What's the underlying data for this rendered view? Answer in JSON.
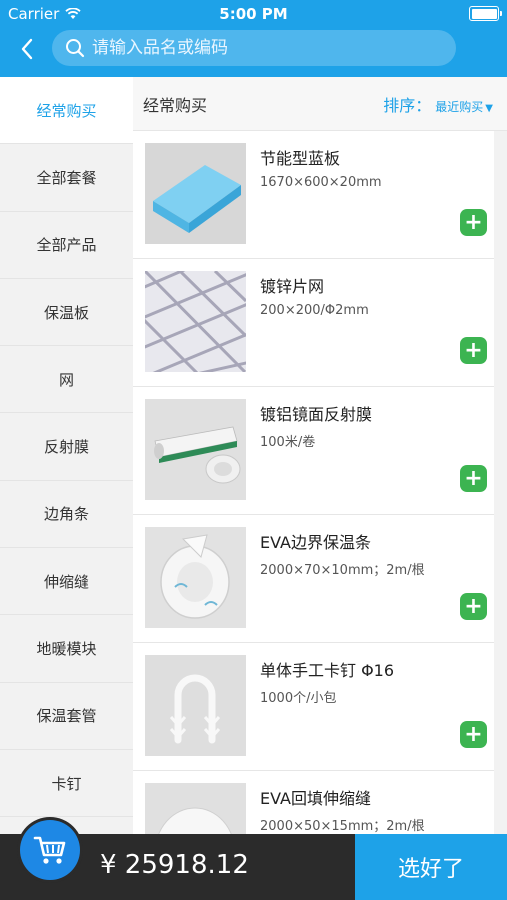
{
  "status_bar": {
    "carrier": "Carrier",
    "time": "5:00 PM"
  },
  "search": {
    "placeholder": "请输入品名或编码"
  },
  "sidebar": {
    "items": [
      {
        "label": "经常购买",
        "active": true
      },
      {
        "label": "全部套餐"
      },
      {
        "label": "全部产品"
      },
      {
        "label": "保温板"
      },
      {
        "label": "网"
      },
      {
        "label": "反射膜"
      },
      {
        "label": "边角条"
      },
      {
        "label": "伸缩缝"
      },
      {
        "label": "地暖模块"
      },
      {
        "label": "保温套管"
      },
      {
        "label": "卡钉"
      },
      {
        "label": ""
      }
    ]
  },
  "main": {
    "title": "经常购买",
    "sort_label": "排序：",
    "sort_value": "最近购买"
  },
  "products": [
    {
      "name": "节能型蓝板",
      "spec": "1670×600×20mm",
      "image": "blue-board-image"
    },
    {
      "name": "镀锌片网",
      "spec": "200×200/Φ2mm",
      "image": "wire-mesh-image"
    },
    {
      "name": "镀铝镜面反射膜",
      "spec": "100米/卷",
      "image": "reflective-film-image"
    },
    {
      "name": "EVA边界保温条",
      "spec": "2000×70×10mm；2m/根",
      "image": "eva-strip-image"
    },
    {
      "name": "单体手工卡钉 Φ16",
      "spec": "1000个/小包",
      "image": "staple-image"
    },
    {
      "name": "EVA回填伸缩缝",
      "spec": "2000×50×15mm；2m/根",
      "image": "expansion-joint-image"
    }
  ],
  "bottom": {
    "total": "¥ 25918.12",
    "done_label": "选好了"
  },
  "colors": {
    "accent": "#1ea2e8",
    "add": "#3cb451",
    "bottom_bar": "#2b2b2b",
    "cart": "#1e88e5"
  }
}
